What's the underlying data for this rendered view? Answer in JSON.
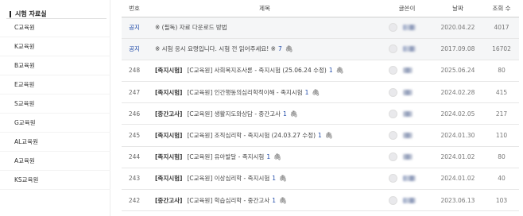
{
  "sidebar": {
    "title": "시험 자료실",
    "items": [
      {
        "label": "C교육원"
      },
      {
        "label": "K교육원"
      },
      {
        "label": "B교육원"
      },
      {
        "label": "E교육원"
      },
      {
        "label": "S교육원"
      },
      {
        "label": "G교육원"
      },
      {
        "label": "AL교육원"
      },
      {
        "label": "A교육원"
      },
      {
        "label": "KS교육원"
      }
    ]
  },
  "table": {
    "headers": {
      "num": "번호",
      "title": "제목",
      "author": "글쓴이",
      "date": "날짜",
      "views": "조회 수"
    },
    "rows": [
      {
        "num": "공지",
        "tag": "",
        "title": "※ (필독) 자료 다운로드 방법",
        "count": "",
        "date": "2020.04.22",
        "views": "4017",
        "notice": true
      },
      {
        "num": "공지",
        "tag": "",
        "title": "※ 시험 응시 요령입니다. 시험 전 읽어주세요! ※",
        "count": "7",
        "date": "2017.09.08",
        "views": "16702",
        "notice": true
      },
      {
        "num": "248",
        "tag": "[족지시험]",
        "title": "[C교육원] 사회복지조사론 - 족지시험 (25.06.24 수정)",
        "count": "1",
        "date": "2025.06.24",
        "views": "80",
        "notice": false
      },
      {
        "num": "247",
        "tag": "[족지시험]",
        "title": "[C교육원] 인간행동의심리학적이해 - 족지시험",
        "count": "1",
        "date": "2024.02.28",
        "views": "415",
        "notice": false
      },
      {
        "num": "246",
        "tag": "[중간고사]",
        "title": "[C교육원] 생활지도와상담 - 중간고사",
        "count": "1",
        "date": "2024.02.05",
        "views": "217",
        "notice": false
      },
      {
        "num": "245",
        "tag": "[족지시험]",
        "title": "[C교육원] 조직심리학 - 족지시험 (24.03.27 수정)",
        "count": "1",
        "date": "2024.01.30",
        "views": "110",
        "notice": false
      },
      {
        "num": "244",
        "tag": "[족지시험]",
        "title": "[C교육원] 유아발달 - 족지시험",
        "count": "1",
        "date": "2024.01.02",
        "views": "80",
        "notice": false
      },
      {
        "num": "243",
        "tag": "[족지시험]",
        "title": "[C교육원] 이상심리학 - 족지시험",
        "count": "1",
        "date": "2024.01.02",
        "views": "40",
        "notice": false
      },
      {
        "num": "242",
        "tag": "[중간고사]",
        "title": "[C교육원] 학습심리학 - 중간고사",
        "count": "1",
        "date": "2023.06.13",
        "views": "103",
        "notice": false
      }
    ]
  },
  "icons": {
    "attachment": "paperclip-icon",
    "avatar": "avatar"
  },
  "colors": {
    "accent": "#1f4aa8",
    "notice_bg": "#f5f6f7"
  }
}
